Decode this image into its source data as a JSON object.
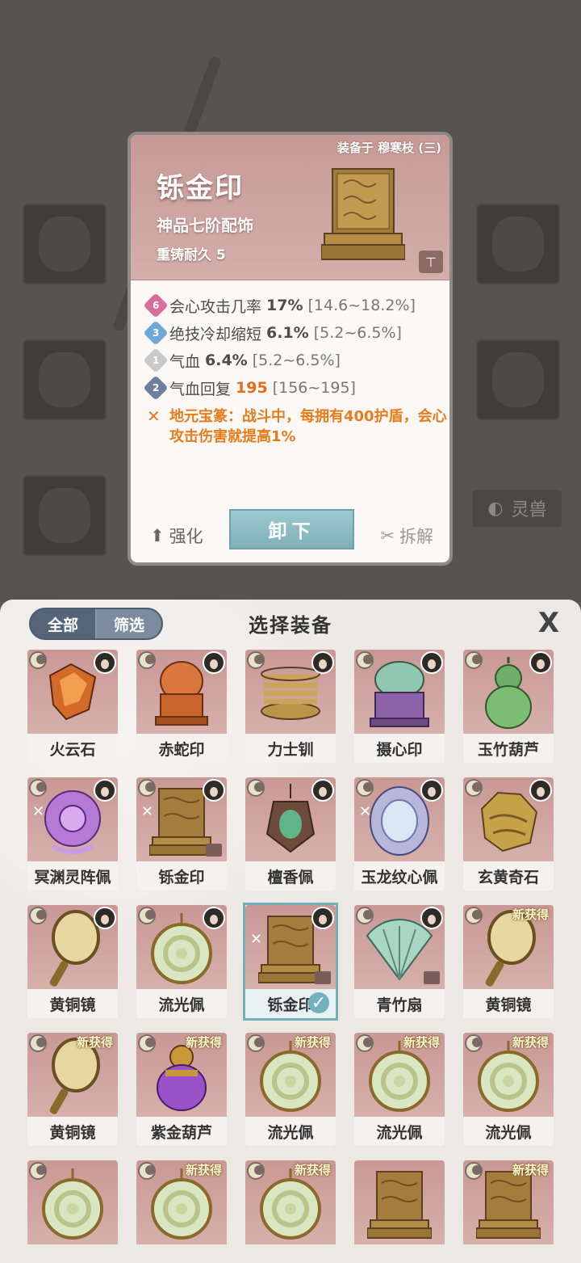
{
  "background": {
    "beast_tab_label": "灵兽"
  },
  "detail": {
    "equipped_on": "装备于 穆寒枝 (三)",
    "name": "铄金印",
    "grade": "神品七阶配饰",
    "durability": "重铸耐久 5",
    "stats": [
      {
        "badge": "6",
        "badge_color": "#d86c9a",
        "name": "会心攻击几率",
        "value": "17%",
        "range": "[14.6~18.2%]",
        "highlight": false
      },
      {
        "badge": "3",
        "badge_color": "#6fa7d8",
        "name": "绝技冷却缩短",
        "value": "6.1%",
        "range": "[5.2~6.5%]",
        "highlight": false
      },
      {
        "badge": "1",
        "badge_color": "#c9c9c9",
        "name": "气血",
        "value": "6.4%",
        "range": "[5.2~6.5%]",
        "highlight": false
      },
      {
        "badge": "2",
        "badge_color": "#6d7f9c",
        "name": "气血回复",
        "value": "195",
        "range": "[156~195]",
        "highlight": true
      }
    ],
    "special": "地元宝篆：战斗中，每拥有400护盾，会心攻击伤害就提高1%",
    "actions": {
      "strengthen": "强化",
      "unequip": "卸下",
      "dismantle": "拆解"
    }
  },
  "panel": {
    "title": "选择装备",
    "filter_all": "全部",
    "filter_select": "筛选",
    "close": "X"
  },
  "items": [
    {
      "name": "火云石",
      "moon": true,
      "avatar": true,
      "new": false,
      "chain": false,
      "lock": false,
      "art": "stone-red"
    },
    {
      "name": "赤蛇印",
      "moon": true,
      "avatar": true,
      "new": false,
      "chain": false,
      "lock": false,
      "art": "seal-orange"
    },
    {
      "name": "力士钏",
      "moon": true,
      "avatar": true,
      "new": false,
      "chain": false,
      "lock": false,
      "art": "bracelet"
    },
    {
      "name": "摄心印",
      "moon": true,
      "avatar": true,
      "new": false,
      "chain": false,
      "lock": false,
      "art": "seal-purple"
    },
    {
      "name": "玉竹葫芦",
      "moon": true,
      "avatar": true,
      "new": false,
      "chain": false,
      "lock": false,
      "art": "gourd-green"
    },
    {
      "name": "冥渊灵阵佩",
      "moon": true,
      "avatar": true,
      "new": false,
      "chain": true,
      "lock": false,
      "art": "disc-purple"
    },
    {
      "name": "铄金印",
      "moon": true,
      "avatar": true,
      "new": false,
      "chain": true,
      "lock": true,
      "art": "seal-gold"
    },
    {
      "name": "檀香佩",
      "moon": true,
      "avatar": true,
      "new": false,
      "chain": false,
      "lock": false,
      "art": "pendant-green"
    },
    {
      "name": "玉龙纹心佩",
      "moon": true,
      "avatar": true,
      "new": false,
      "chain": true,
      "lock": false,
      "art": "disc-blue"
    },
    {
      "name": "玄黄奇石",
      "moon": true,
      "avatar": true,
      "new": false,
      "chain": false,
      "lock": false,
      "art": "stone-gold"
    },
    {
      "name": "黄铜镜",
      "moon": true,
      "avatar": true,
      "new": false,
      "chain": false,
      "lock": false,
      "art": "mirror"
    },
    {
      "name": "流光佩",
      "moon": true,
      "avatar": true,
      "new": false,
      "chain": false,
      "lock": false,
      "art": "ring-jade"
    },
    {
      "name": "铄金印",
      "moon": false,
      "avatar": true,
      "new": false,
      "chain": true,
      "lock": true,
      "art": "seal-gold",
      "selected": true
    },
    {
      "name": "青竹扇",
      "moon": true,
      "avatar": true,
      "new": false,
      "chain": false,
      "lock": true,
      "art": "fan"
    },
    {
      "name": "黄铜镜",
      "moon": true,
      "avatar": false,
      "new": true,
      "chain": false,
      "lock": false,
      "art": "mirror"
    },
    {
      "name": "黄铜镜",
      "moon": true,
      "avatar": false,
      "new": true,
      "chain": false,
      "lock": false,
      "art": "mirror"
    },
    {
      "name": "紫金葫芦",
      "moon": true,
      "avatar": false,
      "new": true,
      "chain": false,
      "lock": false,
      "art": "gourd-purple"
    },
    {
      "name": "流光佩",
      "moon": true,
      "avatar": false,
      "new": true,
      "chain": false,
      "lock": false,
      "art": "ring-jade"
    },
    {
      "name": "流光佩",
      "moon": true,
      "avatar": false,
      "new": true,
      "chain": false,
      "lock": false,
      "art": "ring-jade"
    },
    {
      "name": "流光佩",
      "moon": true,
      "avatar": false,
      "new": true,
      "chain": false,
      "lock": false,
      "art": "ring-jade"
    },
    {
      "name": "",
      "moon": true,
      "avatar": false,
      "new": false,
      "chain": false,
      "lock": false,
      "art": "ring-jade"
    },
    {
      "name": "",
      "moon": true,
      "avatar": false,
      "new": true,
      "chain": false,
      "lock": false,
      "art": "ring-jade"
    },
    {
      "name": "",
      "moon": true,
      "avatar": false,
      "new": true,
      "chain": false,
      "lock": false,
      "art": "ring-jade"
    },
    {
      "name": "",
      "moon": false,
      "avatar": false,
      "new": false,
      "chain": false,
      "lock": false,
      "art": "seal-gold"
    },
    {
      "name": "",
      "moon": true,
      "avatar": false,
      "new": true,
      "chain": false,
      "lock": false,
      "art": "seal-gold"
    }
  ],
  "new_badge_label": "新获得"
}
